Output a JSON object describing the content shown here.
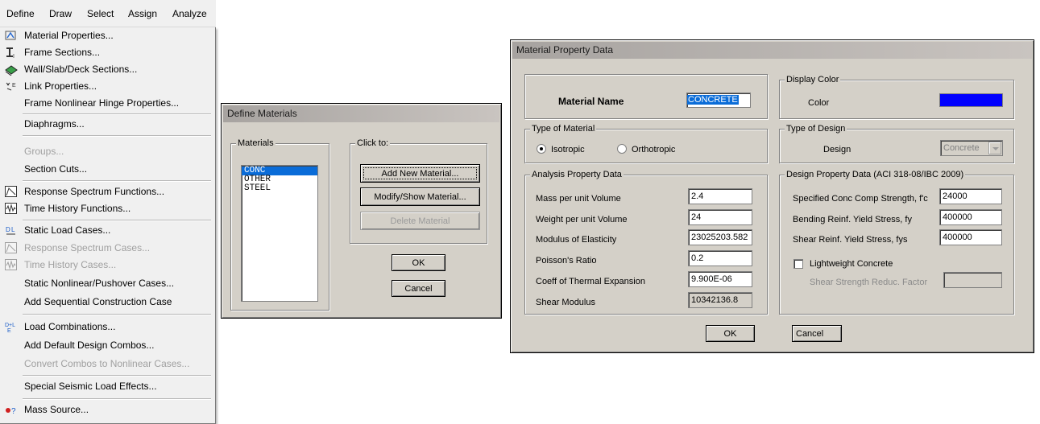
{
  "menubar": {
    "items": [
      "Define",
      "Draw",
      "Select",
      "Assign",
      "Analyze"
    ]
  },
  "define_menu": {
    "items": [
      {
        "label": "Material Properties...",
        "icon": "material-icon",
        "disabled": false
      },
      {
        "label": "Frame Sections...",
        "icon": "frame-section-icon",
        "disabled": false
      },
      {
        "label": "Wall/Slab/Deck Sections...",
        "icon": "wall-slab-icon",
        "disabled": false
      },
      {
        "label": "Link Properties...",
        "icon": "link-icon",
        "disabled": false
      },
      {
        "label": "Frame Nonlinear Hinge Properties...",
        "icon": "",
        "disabled": false
      },
      {
        "label": "Diaphragms...",
        "icon": "",
        "disabled": false
      },
      {
        "label": "Groups...",
        "icon": "",
        "disabled": true
      },
      {
        "label": "Section Cuts...",
        "icon": "",
        "disabled": false
      },
      {
        "label": "Response Spectrum Functions...",
        "icon": "response-spectrum-icon",
        "disabled": false
      },
      {
        "label": "Time History Functions...",
        "icon": "time-history-icon",
        "disabled": false
      },
      {
        "label": "Static Load Cases...",
        "icon": "static-load-icon",
        "disabled": false
      },
      {
        "label": "Response Spectrum Cases...",
        "icon": "response-spectrum-case-icon",
        "disabled": true
      },
      {
        "label": "Time History Cases...",
        "icon": "time-history-case-icon",
        "disabled": true
      },
      {
        "label": "Static Nonlinear/Pushover Cases...",
        "icon": "",
        "disabled": false
      },
      {
        "label": "Add Sequential Construction Case",
        "icon": "",
        "disabled": false
      },
      {
        "label": "Load Combinations...",
        "icon": "load-combination-icon",
        "disabled": false
      },
      {
        "label": "Add Default Design Combos...",
        "icon": "",
        "disabled": false
      },
      {
        "label": "Convert Combos to Nonlinear Cases...",
        "icon": "",
        "disabled": true
      },
      {
        "label": "Special Seismic Load Effects...",
        "icon": "",
        "disabled": false
      },
      {
        "label": "Mass Source...",
        "icon": "mass-source-icon",
        "disabled": false
      }
    ]
  },
  "define_materials": {
    "title": "Define Materials",
    "materials_label": "Materials",
    "materials": [
      "CONC",
      "OTHER",
      "STEEL"
    ],
    "selected_material": "CONC",
    "click_to_label": "Click to:",
    "add_button": "Add New Material...",
    "modify_button": "Modify/Show Material...",
    "delete_button": "Delete Material",
    "ok_button": "OK",
    "cancel_button": "Cancel"
  },
  "material_property": {
    "title": "Material Property Data",
    "material_name_label": "Material Name",
    "material_name": "CONCRETE",
    "display_color_label": "Display Color",
    "color_label": "Color",
    "color_value": "#0000ff",
    "type_of_material_label": "Type of Material",
    "isotropic_label": "Isotropic",
    "orthotropic_label": "Orthotropic",
    "type_of_design_label": "Type of Design",
    "design_label": "Design",
    "design_value": "Concrete",
    "analysis_label": "Analysis Property Data",
    "analysis_rows": [
      {
        "label": "Mass per unit Volume",
        "value": "2.4"
      },
      {
        "label": "Weight per unit Volume",
        "value": "24"
      },
      {
        "label": "Modulus of Elasticity",
        "value": "23025203.582"
      },
      {
        "label": "Poisson's Ratio",
        "value": "0.2"
      },
      {
        "label": "Coeff of Thermal Expansion",
        "value": "9.900E-06"
      },
      {
        "label": "Shear Modulus",
        "value": "10342136.8"
      }
    ],
    "design_data_label": "Design Property Data (ACI 318-08/IBC 2009)",
    "design_rows": [
      {
        "label": "Specified Conc Comp Strength, f'c",
        "value": "24000"
      },
      {
        "label": "Bending Reinf. Yield Stress, fy",
        "value": "400000"
      },
      {
        "label": "Shear Reinf. Yield Stress, fys",
        "value": "400000"
      }
    ],
    "lightweight_label": "Lightweight Concrete",
    "shear_strength_label": "Shear Strength Reduc. Factor",
    "shear_strength_value": "",
    "ok_button": "OK",
    "cancel_button": "Cancel"
  }
}
